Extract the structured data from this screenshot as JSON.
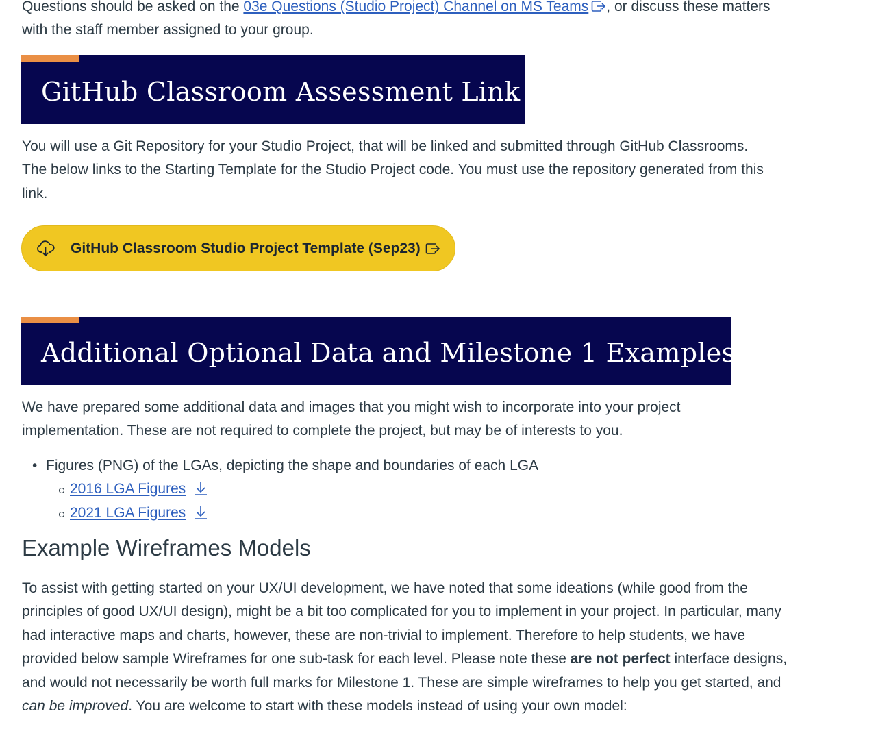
{
  "intro": {
    "text_before": "Questions should be asked on the ",
    "link_text": "03e Questions (Studio Project) Channel on MS Teams",
    "text_after": ", or discuss these matters with the staff member assigned to your group."
  },
  "github_section": {
    "heading": "GitHub Classroom Assessment Link",
    "paragraph": "You will use a Git Repository for your Studio Project, that will be linked and submitted through GitHub Classrooms. The below links to the Starting Template for the Studio Project code. You must use the repository generated from this link.",
    "button_label": "GitHub Classroom Studio Project Template (Sep23)",
    "button_icon": "cloud-download-icon"
  },
  "additional_section": {
    "heading": "Additional Optional Data and Milestone 1 Examples",
    "paragraph": "We have prepared some additional data and images that you might wish to incorporate into your project implementation. These are not required to complete the project, but may be of interests to you.",
    "bullet": "Figures (PNG) of the LGAs, depicting the shape and boundaries of each LGA",
    "sub_links": [
      {
        "label": "2016 LGA Figures",
        "icon": "download-icon"
      },
      {
        "label": "2021 LGA Figures",
        "icon": "download-icon"
      }
    ]
  },
  "wireframes": {
    "heading": "Example Wireframes Models",
    "p1": "To assist with getting started on your UX/UI development, we have noted that some ideations (while good from the principles of good UX/UI design), might be a bit too complicated for you to implement in your project. In particular, many had interactive maps and charts, however, these are non-trivial to implement. Therefore to help students, we have provided below sample Wireframes for one sub-task for each level. Please note these ",
    "bold": "are not perfect",
    "p2": " interface designs, and would not necessarily be worth full marks for Milestone 1. These are simple wireframes to help you get started, and ",
    "italic": "can be improved",
    "p3": ". You are welcome to start with these models instead of using your own model:"
  },
  "colors": {
    "banner_bg": "#06064f",
    "banner_accent": "#ea8f45",
    "button_bg": "#f0c722",
    "link": "#2d5fbe",
    "text": "#2d3b45"
  }
}
